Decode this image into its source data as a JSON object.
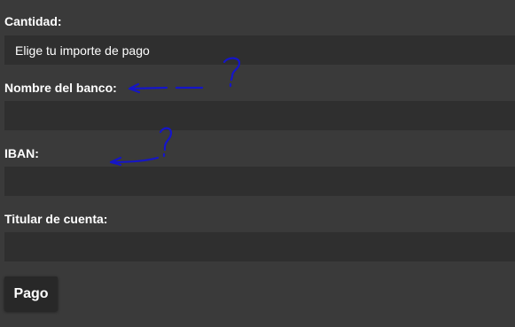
{
  "form": {
    "amount_label": "Cantidad:",
    "amount_select_value": "Elige tu importe de pago",
    "bank_name_label": "Nombre del banco:",
    "bank_name_value": "",
    "iban_label": "IBAN:",
    "iban_value": "",
    "account_holder_label": "Titular de cuenta:",
    "account_holder_value": "",
    "pay_button_label": "Pago"
  },
  "annotations": {
    "color": "#1515c8",
    "marks": [
      "?",
      "?"
    ]
  }
}
